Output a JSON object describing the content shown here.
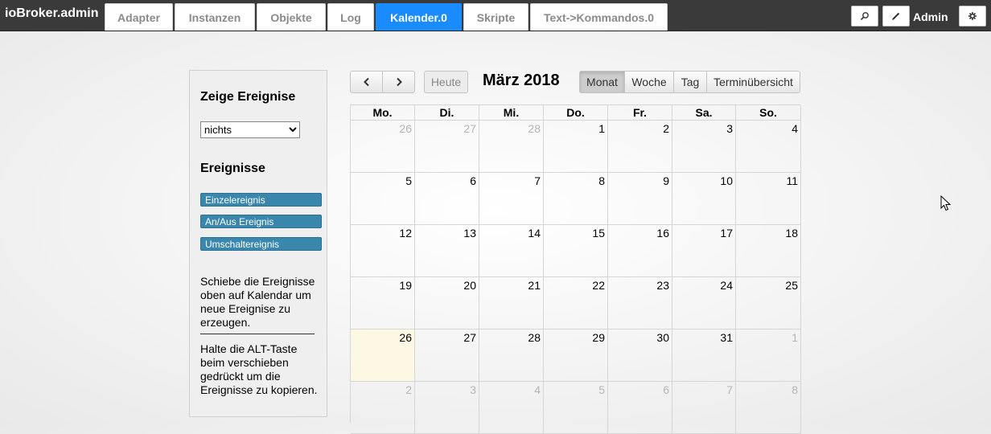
{
  "app": {
    "brand": "ioBroker.admin",
    "user": "Admin"
  },
  "tabs": [
    {
      "label": "Adapter",
      "active": false
    },
    {
      "label": "Instanzen",
      "active": false
    },
    {
      "label": "Objekte",
      "active": false
    },
    {
      "label": "Log",
      "active": false
    },
    {
      "label": "Kalender.0",
      "active": true
    },
    {
      "label": "Skripte",
      "active": false
    },
    {
      "label": "Text->Kommandos.0",
      "active": false
    }
  ],
  "topbar_icons": [
    "search-icon",
    "pencil-icon",
    "gear-icon"
  ],
  "sidebar": {
    "show_events_title": "Zeige Ereignise",
    "show_events_select": "nichts",
    "events_title": "Ereignisse",
    "events": [
      "Einzelereignis",
      "An/Aus Ereignis",
      "Umschaltereignis"
    ],
    "hint_drag": "Schiebe die Ereignisse oben auf Kalendar um neue Ereignise zu erzeugen.",
    "hint_alt": "Halte die ALT-Taste beim verschieben gedrückt um die Ereignisse zu kopieren."
  },
  "toolbar": {
    "prev_icon": "chevron-left-icon",
    "next_icon": "chevron-right-icon",
    "today_label": "Heute",
    "title": "März 2018",
    "views": [
      {
        "label": "Monat",
        "active": true
      },
      {
        "label": "Woche",
        "active": false
      },
      {
        "label": "Tag",
        "active": false
      },
      {
        "label": "Terminübersicht",
        "active": false
      }
    ]
  },
  "calendar": {
    "weekdays": [
      "Mo.",
      "Di.",
      "Mi.",
      "Do.",
      "Fr.",
      "Sa.",
      "So."
    ],
    "weeks": [
      [
        [
          "26",
          true
        ],
        [
          "27",
          true
        ],
        [
          "28",
          true
        ],
        [
          "1",
          false
        ],
        [
          "2",
          false
        ],
        [
          "3",
          false
        ],
        [
          "4",
          false
        ]
      ],
      [
        [
          "5",
          false
        ],
        [
          "6",
          false
        ],
        [
          "7",
          false
        ],
        [
          "8",
          false
        ],
        [
          "9",
          false
        ],
        [
          "10",
          false
        ],
        [
          "11",
          false
        ]
      ],
      [
        [
          "12",
          false
        ],
        [
          "13",
          false
        ],
        [
          "14",
          false
        ],
        [
          "15",
          false
        ],
        [
          "16",
          false
        ],
        [
          "17",
          false
        ],
        [
          "18",
          false
        ]
      ],
      [
        [
          "19",
          false
        ],
        [
          "20",
          false
        ],
        [
          "21",
          false
        ],
        [
          "22",
          false
        ],
        [
          "23",
          false
        ],
        [
          "24",
          false
        ],
        [
          "25",
          false
        ]
      ],
      [
        [
          "26",
          false
        ],
        [
          "27",
          false
        ],
        [
          "28",
          false
        ],
        [
          "29",
          false
        ],
        [
          "30",
          false
        ],
        [
          "31",
          false
        ],
        [
          "1",
          true
        ]
      ],
      [
        [
          "2",
          true
        ],
        [
          "3",
          true
        ],
        [
          "4",
          true
        ],
        [
          "5",
          true
        ],
        [
          "6",
          true
        ],
        [
          "7",
          true
        ],
        [
          "8",
          true
        ]
      ]
    ],
    "today": "26",
    "today_color": "#fcf8e3"
  },
  "colors": {
    "active_tab": "#1a8cff",
    "event": "#3a87ad",
    "topbar": "#3a3a3a"
  }
}
